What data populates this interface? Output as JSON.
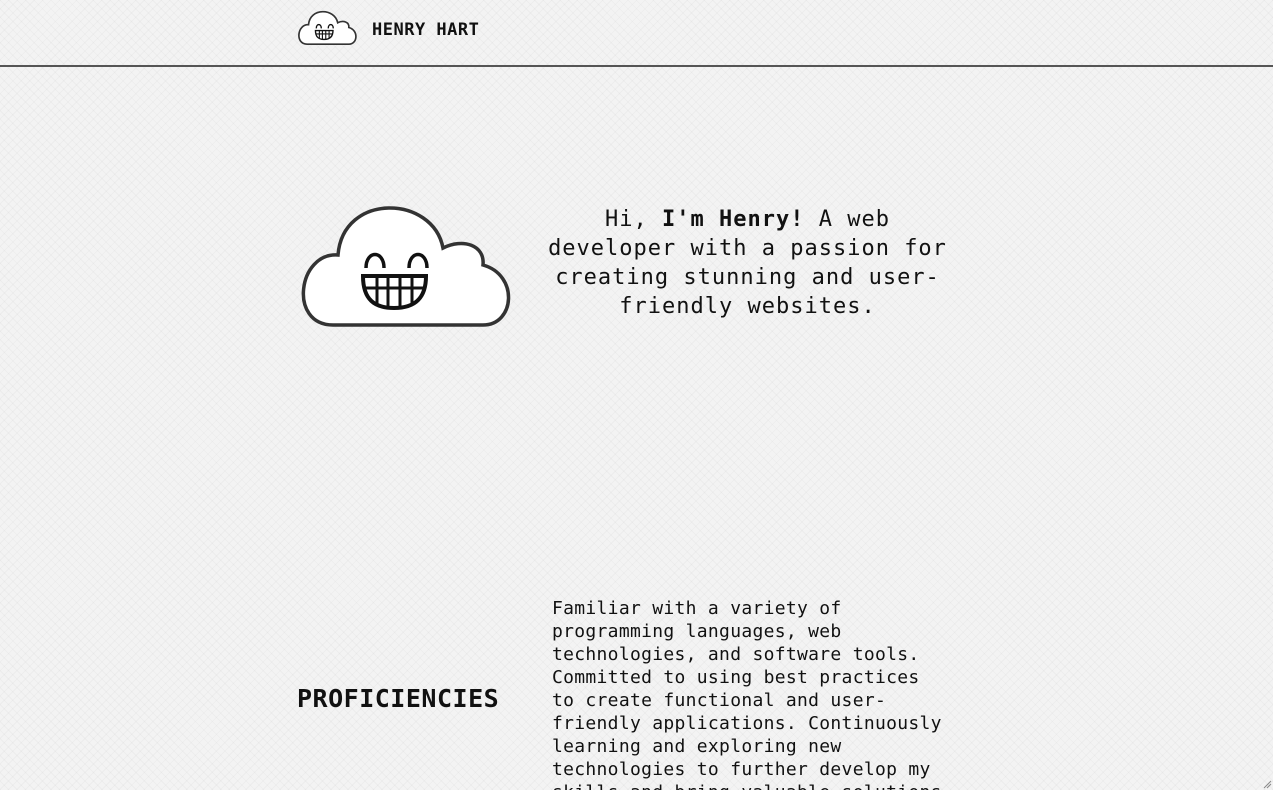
{
  "header": {
    "brand_name": "HENRY HART",
    "logo_icon": "smiling-cloud-icon"
  },
  "hero": {
    "cloud_icon": "smiling-cloud-icon",
    "greeting": "Hi,",
    "name": "I'm Henry!",
    "tagline": "A web developer with a passion for creating stunning and user-friendly websites."
  },
  "proficiencies": {
    "title": "PROFICIENCIES",
    "description": "Familiar with a variety of programming languages, web technologies, and software tools. Committed to using best practices to create functional and user-friendly applications. Continuously learning and exploring new technologies to further develop my skills and bring valuable solutions to the table."
  }
}
